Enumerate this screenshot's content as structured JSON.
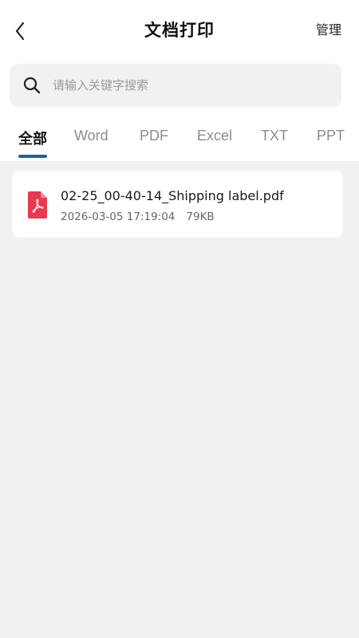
{
  "header": {
    "title": "文档打印",
    "manage_label": "管理",
    "back_icon": "chevron-left-icon"
  },
  "search": {
    "placeholder": "请输入关键字搜索",
    "value": "",
    "icon": "search-icon"
  },
  "tabs": [
    {
      "label": "全部",
      "active": true
    },
    {
      "label": "Word",
      "active": false
    },
    {
      "label": "PDF",
      "active": false
    },
    {
      "label": "Excel",
      "active": false
    },
    {
      "label": "TXT",
      "active": false
    },
    {
      "label": "PPT",
      "active": false
    }
  ],
  "files": [
    {
      "name": "02-25_00-40-14_Shipping label.pdf",
      "date": "2026-03-05 17:19:04",
      "size": "79KB",
      "icon": "pdf-file-icon"
    }
  ],
  "colors": {
    "accent": "#1b5fb0",
    "pdf_red": "#e8394f",
    "background": "#f1f1f1"
  }
}
